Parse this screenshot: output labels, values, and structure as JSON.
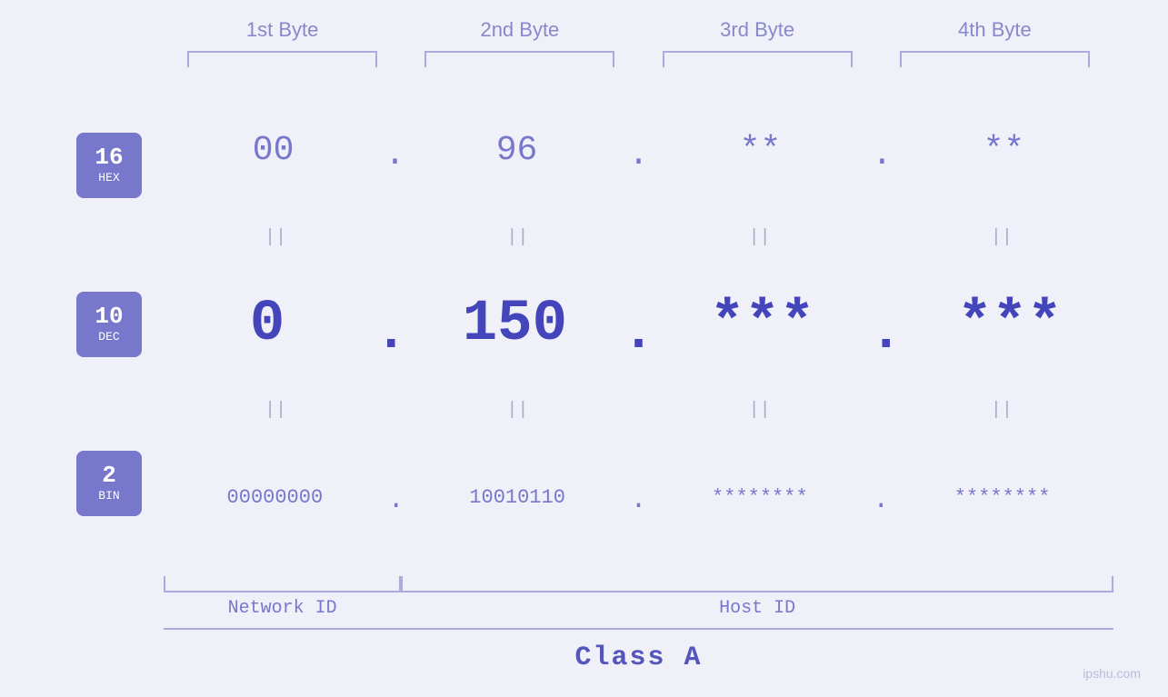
{
  "headers": {
    "byte1": "1st Byte",
    "byte2": "2nd Byte",
    "byte3": "3rd Byte",
    "byte4": "4th Byte"
  },
  "badges": {
    "hex": {
      "num": "16",
      "label": "HEX"
    },
    "dec": {
      "num": "10",
      "label": "DEC"
    },
    "bin": {
      "num": "2",
      "label": "BIN"
    }
  },
  "hex_row": {
    "b1": "00",
    "b2": "96",
    "b3": "**",
    "b4": "**"
  },
  "dec_row": {
    "b1": "0",
    "b2": "150",
    "b3": "***",
    "b4": "***"
  },
  "bin_row": {
    "b1": "00000000",
    "b2": "10010110",
    "b3": "********",
    "b4": "********"
  },
  "labels": {
    "network_id": "Network ID",
    "host_id": "Host ID",
    "class": "Class A"
  },
  "equals": "||",
  "watermark": "ipshu.com"
}
